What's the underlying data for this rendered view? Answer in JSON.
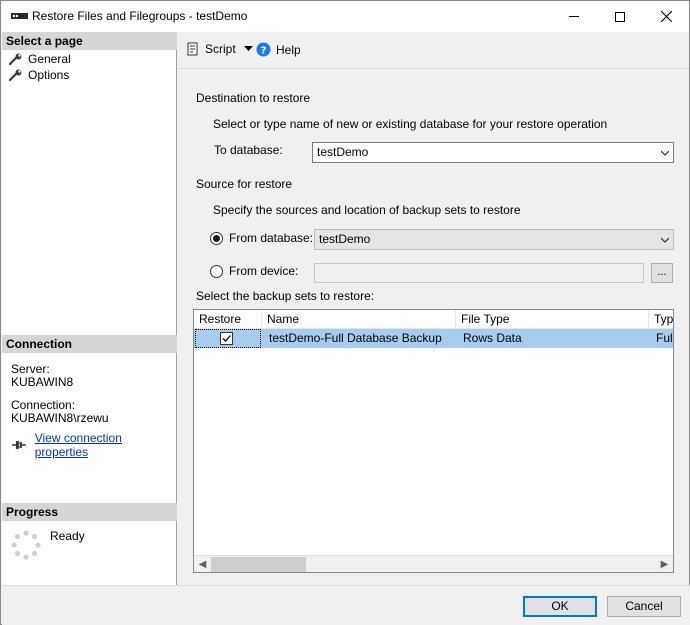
{
  "window": {
    "title": "Restore Files and Filegroups - testDemo",
    "minimize": "—",
    "maximize": "☐",
    "close": "✕"
  },
  "sidebar": {
    "select_page_header": "Select a page",
    "pages": [
      {
        "label": "General"
      },
      {
        "label": "Options"
      }
    ],
    "connection_header": "Connection",
    "server_label": "Server:",
    "server_value": "KUBAWIN8",
    "connection_label": "Connection:",
    "connection_value": "KUBAWIN8\\rzewu",
    "view_props_link": "View connection properties",
    "progress_header": "Progress",
    "progress_status": "Ready"
  },
  "toolbar": {
    "script_label": "Script",
    "help_label": "Help"
  },
  "destination": {
    "group_label": "Destination to restore",
    "instruction": "Select or type name of new or existing database for your restore operation",
    "to_database_label": "To database:",
    "to_database_value": "testDemo"
  },
  "source": {
    "group_label": "Source for restore",
    "instruction": "Specify the sources and location of backup sets to restore",
    "from_database_label": "From database:",
    "from_database_value": "testDemo",
    "from_database_selected": true,
    "from_device_label": "From device:",
    "from_device_value": "",
    "browse_label": "..."
  },
  "backup_sets": {
    "label": "Select the backup sets to restore:",
    "columns": [
      "Restore",
      "Name",
      "File Type",
      "Type"
    ],
    "rows": [
      {
        "restore": true,
        "name": "testDemo-Full Database Backup",
        "file_type": "Rows Data",
        "type": "Full"
      }
    ],
    "scroll_left": "◀",
    "scroll_right": "▶"
  },
  "footer": {
    "ok_label": "OK",
    "cancel_label": "Cancel"
  }
}
